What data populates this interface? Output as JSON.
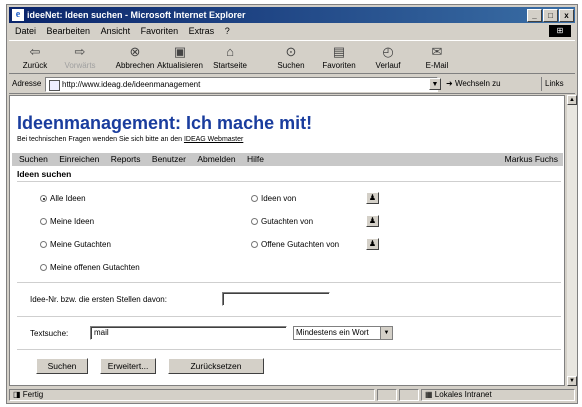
{
  "window": {
    "title": "ideeNet: Ideen suchen - Microsoft Internet Explorer",
    "controls": [
      "_",
      "□",
      "x"
    ]
  },
  "menu": [
    "Datei",
    "Bearbeiten",
    "Ansicht",
    "Favoriten",
    "Extras",
    "?"
  ],
  "toolbar": {
    "back": "Zurück",
    "forward": "Vorwärts",
    "stop": "Abbrechen",
    "refresh": "Aktualisieren",
    "home": "Startseite",
    "search": "Suchen",
    "favorites": "Favoriten",
    "history": "Verlauf",
    "mail": "E-Mail"
  },
  "address": {
    "label": "Adresse",
    "url": "http://www.ideag.de/ideenmanagement",
    "go": "Wechseln zu",
    "links": "Links"
  },
  "page": {
    "title": "Ideenmanagement: Ich mache mit!",
    "subline": "Bei technischen Fragen wenden Sie sich bitte an den",
    "webmaster": "IDEAG Webmaster",
    "nav": [
      "Suchen",
      "Einreichen",
      "Reports",
      "Benutzer",
      "Abmelden",
      "Hilfe"
    ],
    "user": "Markus Fuchs",
    "section_title": "Ideen suchen",
    "radios_left": [
      "Alle Ideen",
      "Meine Ideen",
      "Meine Gutachten",
      "Meine offenen Gutachten"
    ],
    "radios_right": [
      "Ideen von",
      "Gutachten von",
      "Offene Gutachten von"
    ],
    "selected_radio": "Alle Ideen",
    "idea_nr_label": "Idee-Nr. bzw. die ersten Stellen davon:",
    "idea_nr_value": "",
    "text_search_label": "Textsuche:",
    "text_search_value": "mail",
    "match_option": "Mindestens ein Wort",
    "buttons": {
      "search": "Suchen",
      "extended": "Erweitert...",
      "reset": "Zurücksetzen"
    }
  },
  "status": {
    "text": "Fertig",
    "zone": "Lokales Intranet"
  }
}
